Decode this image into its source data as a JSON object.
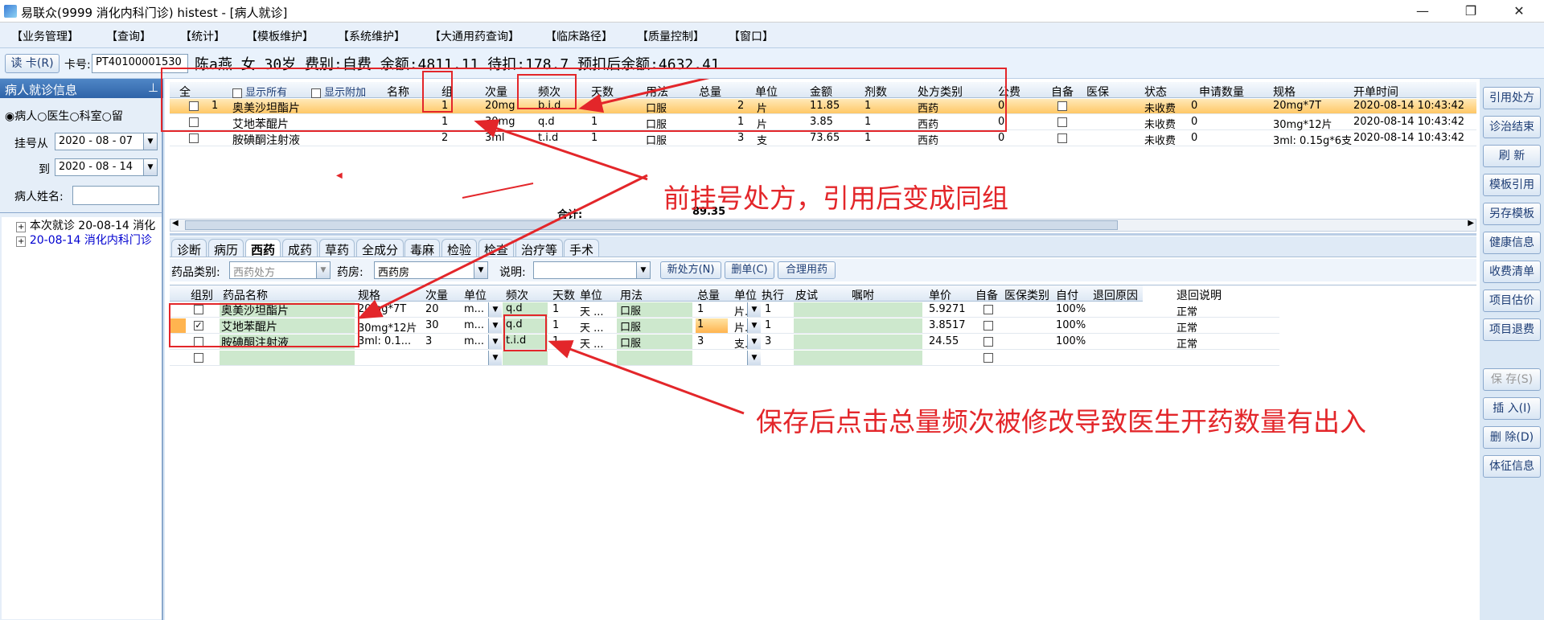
{
  "window": {
    "title": "易联众(9999 消化内科门诊) histest - [病人就诊]"
  },
  "menu": [
    "【业务管理】",
    "【查询】",
    "【统计】",
    "【模板维护】",
    "【系统维护】",
    "【大通用药查询】",
    "【临床路径】",
    "【质量控制】",
    "【窗口】"
  ],
  "patient": {
    "read_card": "读 卡(R)",
    "card_label": "卡号:",
    "card_no": "PT40100001530",
    "summary": "陈a燕 女 30岁 费别:自费 余额:4811.11 待扣:178.7 预扣后余额:4632.41"
  },
  "left": {
    "header": "病人就诊信息",
    "pin": "ᵖ",
    "radio_patient": "病人",
    "radio_doctor": "医生",
    "radio_dept": "科室",
    "radio_other": "留",
    "reg_from_label": "挂号从",
    "reg_from": "2020 - 08 - 07",
    "to_label": "到",
    "to": "2020 - 08 - 14",
    "name_label": "病人姓名:",
    "tree": [
      "本次就诊  20-08-14  消化",
      "20-08-14  消化内科门诊"
    ]
  },
  "top_grid": {
    "opts": {
      "show_all": "显示所有",
      "show_extra": "显示附加"
    },
    "headers": [
      "全",
      "",
      "名称",
      "组",
      "次量",
      "频次",
      "天数",
      "用法",
      "总量",
      "单位",
      "金额",
      "剂数",
      "处方类别",
      "公费",
      "自备",
      "医保",
      "状态",
      "申请数量",
      "规格",
      "开单时间"
    ],
    "rows": [
      {
        "idx": "1",
        "name": "奥美沙坦酯片",
        "group": "1",
        "dose": "20mg",
        "freq": "b.i.d",
        "days": "1",
        "usage": "口服",
        "total": "2",
        "unit": "片",
        "amount": "11.85",
        "doses": "1",
        "type": "西药",
        "gongfei": "0",
        "status": "未收费",
        "req": "0",
        "spec": "20mg*7T",
        "time": "2020-08-14 10:43:42"
      },
      {
        "idx": "",
        "name": "艾地苯醌片",
        "group": "1",
        "dose": "30mg",
        "freq": "q.d",
        "days": "1",
        "usage": "口服",
        "total": "1",
        "unit": "片",
        "amount": "3.85",
        "doses": "1",
        "type": "西药",
        "gongfei": "0",
        "status": "未收费",
        "req": "0",
        "spec": "30mg*12片",
        "time": "2020-08-14 10:43:42"
      },
      {
        "idx": "",
        "name": "胺碘酮注射液",
        "group": "2",
        "dose": "3ml",
        "freq": "t.i.d",
        "days": "1",
        "usage": "口服",
        "total": "3",
        "unit": "支",
        "amount": "73.65",
        "doses": "1",
        "type": "西药",
        "gongfei": "0",
        "status": "未收费",
        "req": "0",
        "spec": "3ml: 0.15g*6支",
        "time": "2020-08-14 10:43:42"
      }
    ],
    "total_label": "合计:",
    "total_value": "89.35"
  },
  "tabs": [
    "诊断",
    "病历",
    "西药",
    "成药",
    "草药",
    "全成分",
    "毒麻",
    "检验",
    "检查",
    "治疗等",
    "手术"
  ],
  "filter": {
    "drug_class_label": "药品类别:",
    "drug_class": "西药处方",
    "pharmacy_label": "药房:",
    "pharmacy": "西药房",
    "note_label": "说明:",
    "new_rx": "新处方(N)",
    "del_rx": "删单(C)",
    "rational": "合理用药"
  },
  "bottom_grid": {
    "headers": [
      "组别",
      "药品名称",
      "规格",
      "次量",
      "单位",
      "频次",
      "天数",
      "单位",
      "用法",
      "总量",
      "单位",
      "执行",
      "皮试",
      "嘱咐",
      "单价",
      "自备",
      "医保类别",
      "自付",
      "退回原因",
      "退回说明"
    ],
    "rows": [
      {
        "checked": false,
        "name": "奥美沙坦酯片",
        "spec": "20mg*7T",
        "dose": "20",
        "unit": "m...",
        "freq": "q.d",
        "days": "1",
        "dunit": "天 ...",
        "usage": "口服",
        "total": "1",
        "tunit": "片.",
        "exec": "1",
        "price": "5.9271",
        "selfpay": "100%",
        "note": "正常"
      },
      {
        "checked": true,
        "name": "艾地苯醌片",
        "spec": "30mg*12片",
        "dose": "30",
        "unit": "m...",
        "freq": "q.d",
        "days": "1",
        "dunit": "天 ...",
        "usage": "口服",
        "total": "1",
        "tunit": "片.",
        "exec": "1",
        "price": "3.8517",
        "selfpay": "100%",
        "note": "正常"
      },
      {
        "checked": false,
        "name": "胺碘酮注射液",
        "spec": "3ml: 0.1...",
        "dose": "3",
        "unit": "m...",
        "freq": "t.i.d",
        "days": "1",
        "dunit": "天 ...",
        "usage": "口服",
        "total": "3",
        "tunit": "支.",
        "exec": "3",
        "price": "24.55",
        "selfpay": "100%",
        "note": "正常"
      }
    ]
  },
  "right_buttons": [
    "引用处方",
    "诊治结束",
    "刷 新",
    "模板引用",
    "另存模板",
    "健康信息",
    "收费清单",
    "项目估价",
    "项目退费"
  ],
  "right_buttons2": [
    "保 存(S)",
    "插 入(I)",
    "删 除(D)",
    "体征信息"
  ],
  "annotations": {
    "top": "前挂号处方，引用后变成同组",
    "bottom": "保存后点击总量频次被修改导致医生开药数量有出入"
  }
}
